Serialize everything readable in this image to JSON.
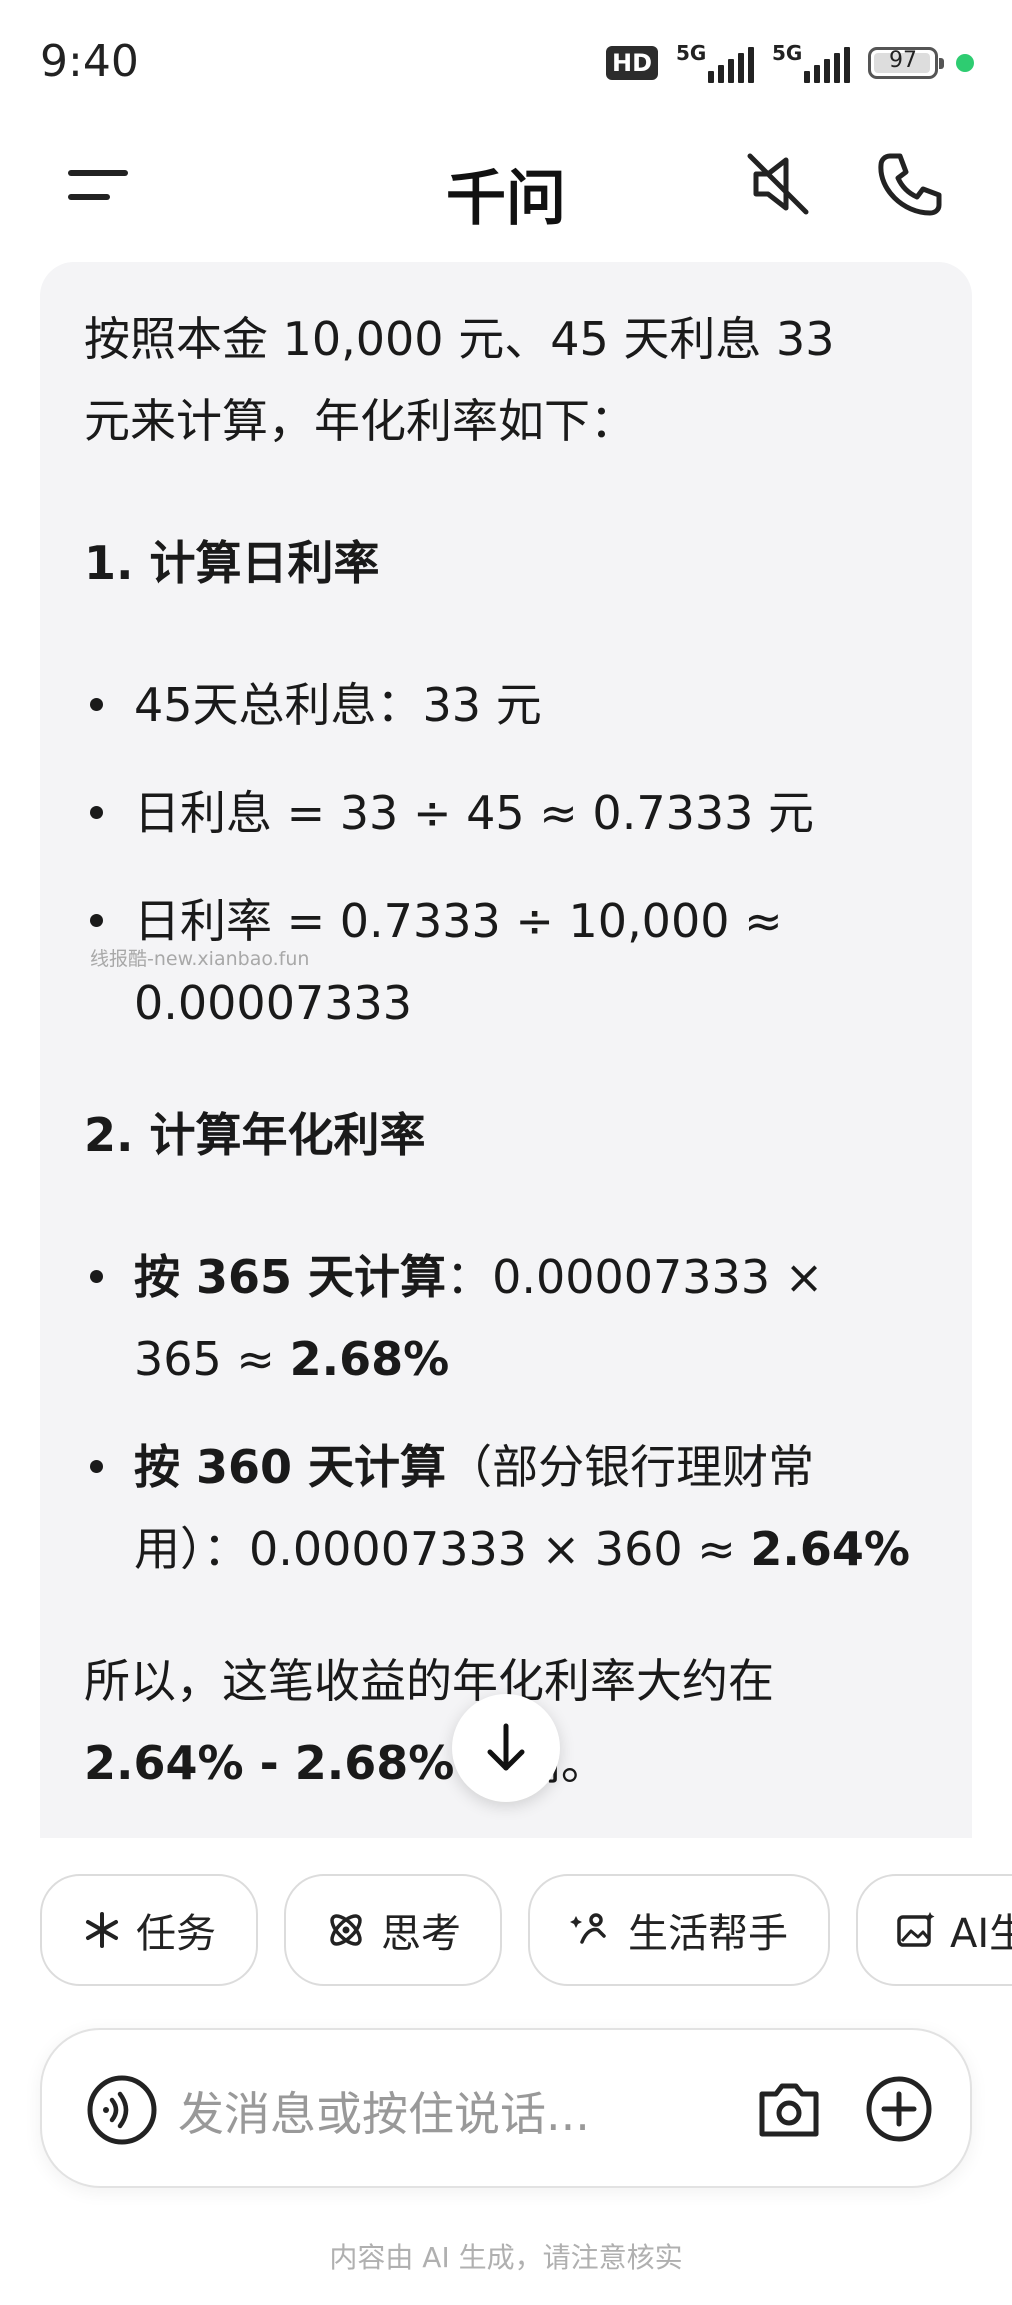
{
  "status_bar": {
    "time": "9:40",
    "hd_label": "HD",
    "sim1_network": "5G",
    "sim2_network": "5G",
    "battery": "97",
    "battery_level": 0.97
  },
  "header": {
    "title": "千问",
    "menu_icon": "menu-icon",
    "mute_icon": "speaker-muted-icon",
    "call_icon": "phone-icon"
  },
  "message": {
    "intro_line1": "按照本金 10,000 元、45 天利息 33",
    "intro_line2": "元来计算，年化利率如下：",
    "section1_title": "1. 计算日利率",
    "section1_items": [
      "45天总利息：33 元",
      "日利息 = 33 ÷ 45 ≈ 0.7333 元",
      "日利率 = 0.7333 ÷ 10,000 ≈"
    ],
    "section1_item3_cont": "0.00007333",
    "watermark": "线报酷-new.xianbao.fun",
    "section2_title": "2. 计算年化利率",
    "item365_bold": "按 365 天计算",
    "item365_line1_rest": "：0.00007333 ×",
    "item365_line2_pre": "365 ≈ ",
    "item365_result": "2.68%",
    "item360_bold": "按 360 天计算",
    "item360_line1_rest": "（部分银行理财常",
    "item360_line2_pre": "用）：0.00007333 × 360 ≈ ",
    "item360_result": "2.64%",
    "conclusion_line1": "所以，这笔收益的年化利率大约在",
    "conclusion_range": "2.64% - 2.68%",
    "conclusion_tail": " 之间。"
  },
  "chips": [
    {
      "label": "任务",
      "icon": "asterisk-icon"
    },
    {
      "label": "思考",
      "icon": "atom-icon"
    },
    {
      "label": "生活帮手",
      "icon": "sparkle-person-icon"
    },
    {
      "label": "AI生",
      "icon": "image-sparkle-icon"
    }
  ],
  "input": {
    "placeholder": "发消息或按住说话...",
    "voice_icon": "voice-icon",
    "camera_icon": "camera-icon",
    "plus_icon": "plus-icon"
  },
  "footer_note": "内容由 AI 生成，请注意核实",
  "colors": {
    "bubble_bg": "#f4f4f6",
    "text": "#1a1a1a",
    "status_green": "#2ecc71"
  }
}
